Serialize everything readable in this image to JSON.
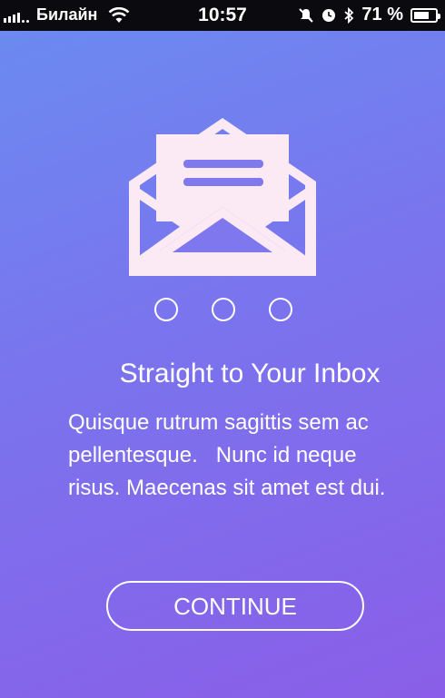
{
  "status_bar": {
    "carrier": "Билайн",
    "time": "10:57",
    "battery_percent": "71 %",
    "battery_level": 0.71,
    "icons": [
      "signal-icon",
      "wifi-icon",
      "silent-icon",
      "alarm-icon",
      "bluetooth-icon",
      "battery-icon"
    ]
  },
  "onboarding": {
    "illustration": "envelope-icon",
    "page_indicators": [
      {
        "active": false
      },
      {
        "active": false
      },
      {
        "active": false
      }
    ],
    "title": "Straight to Your Inbox",
    "body_lines": [
      "Quisque rutrum sagittis sem ac",
      "pellentesque.   Nunc id neque",
      "risus. Maecenas sit amet est dui."
    ],
    "continue_label": "CONTINUE"
  },
  "colors": {
    "gradient_top": "#6a8cf0",
    "gradient_bottom": "#8a5ee8",
    "icon_fill": "#fbe9f4",
    "text": "#ffffff"
  }
}
